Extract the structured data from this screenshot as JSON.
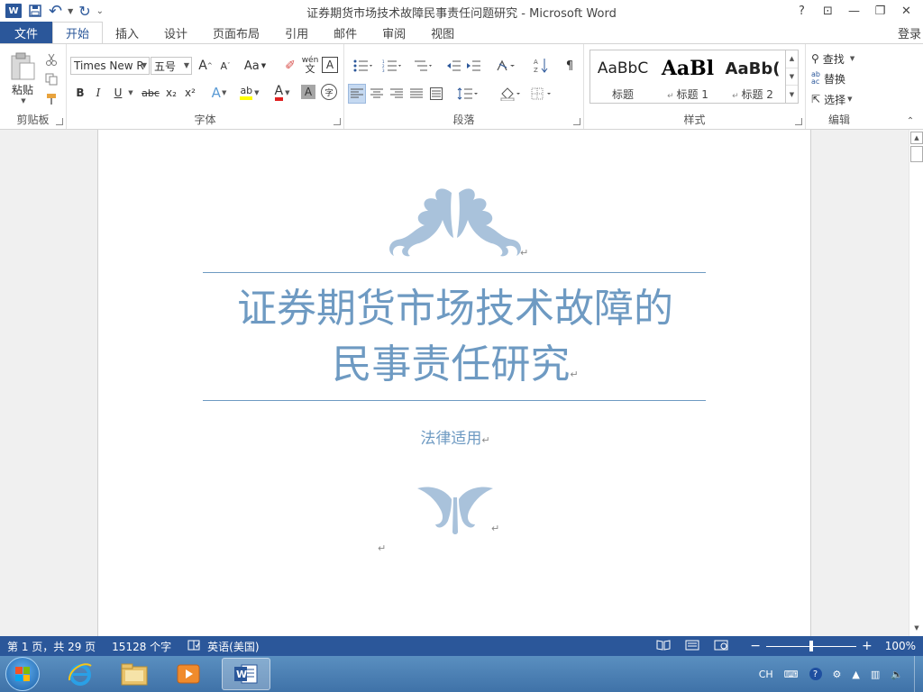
{
  "window": {
    "title": "证券期货市场技术故障民事责任问题研究 - Microsoft Word",
    "help": "?",
    "ribbon_display": "⊡",
    "minimize": "—",
    "restore": "❐",
    "close": "✕"
  },
  "quick_access": {
    "app_icon": "W",
    "save": "💾",
    "undo": "↶",
    "redo": "↻",
    "customize": "⌄"
  },
  "tabs": {
    "file": "文件",
    "items": [
      "开始",
      "插入",
      "设计",
      "页面布局",
      "引用",
      "邮件",
      "审阅",
      "视图"
    ],
    "active": "开始",
    "login": "登录"
  },
  "ribbon": {
    "clipboard": {
      "label": "剪贴板",
      "paste": "粘贴"
    },
    "font": {
      "label": "字体",
      "font_name": "Times New R",
      "font_size": "五号",
      "grow": "A",
      "shrink": "A",
      "change_case": "Aa",
      "clear": "✐",
      "phonetic": "wén",
      "border": "A",
      "bold": "B",
      "italic": "I",
      "underline": "U",
      "strike": "abc",
      "subscript": "x₂",
      "superscript": "x²",
      "effects": "A",
      "highlight": "ab",
      "color": "A",
      "shading": "A",
      "enclose": "字"
    },
    "paragraph": {
      "label": "段落"
    },
    "styles": {
      "label": "样式",
      "items": [
        {
          "sample": "AaBbC",
          "name": "标题"
        },
        {
          "sample": "AaBl",
          "name": "标题 1"
        },
        {
          "sample": "AaBb(",
          "name": "标题 2"
        }
      ]
    },
    "editing": {
      "label": "编辑",
      "find": "查找",
      "replace": "替换",
      "select": "选择"
    }
  },
  "document": {
    "title_line1": "证券期货市场技术故障的",
    "title_line2": "民事责任研究",
    "subtitle": "法律适用",
    "paragraph_mark": "↵"
  },
  "status": {
    "page": "第 1 页，共 29 页",
    "words": "15128 个字",
    "language": "英语(美国)",
    "zoom": "100%"
  },
  "taskbar": {
    "tray_lang": "CH"
  },
  "colors": {
    "accent": "#2b579a",
    "doc_blue": "#6e9ac2"
  }
}
